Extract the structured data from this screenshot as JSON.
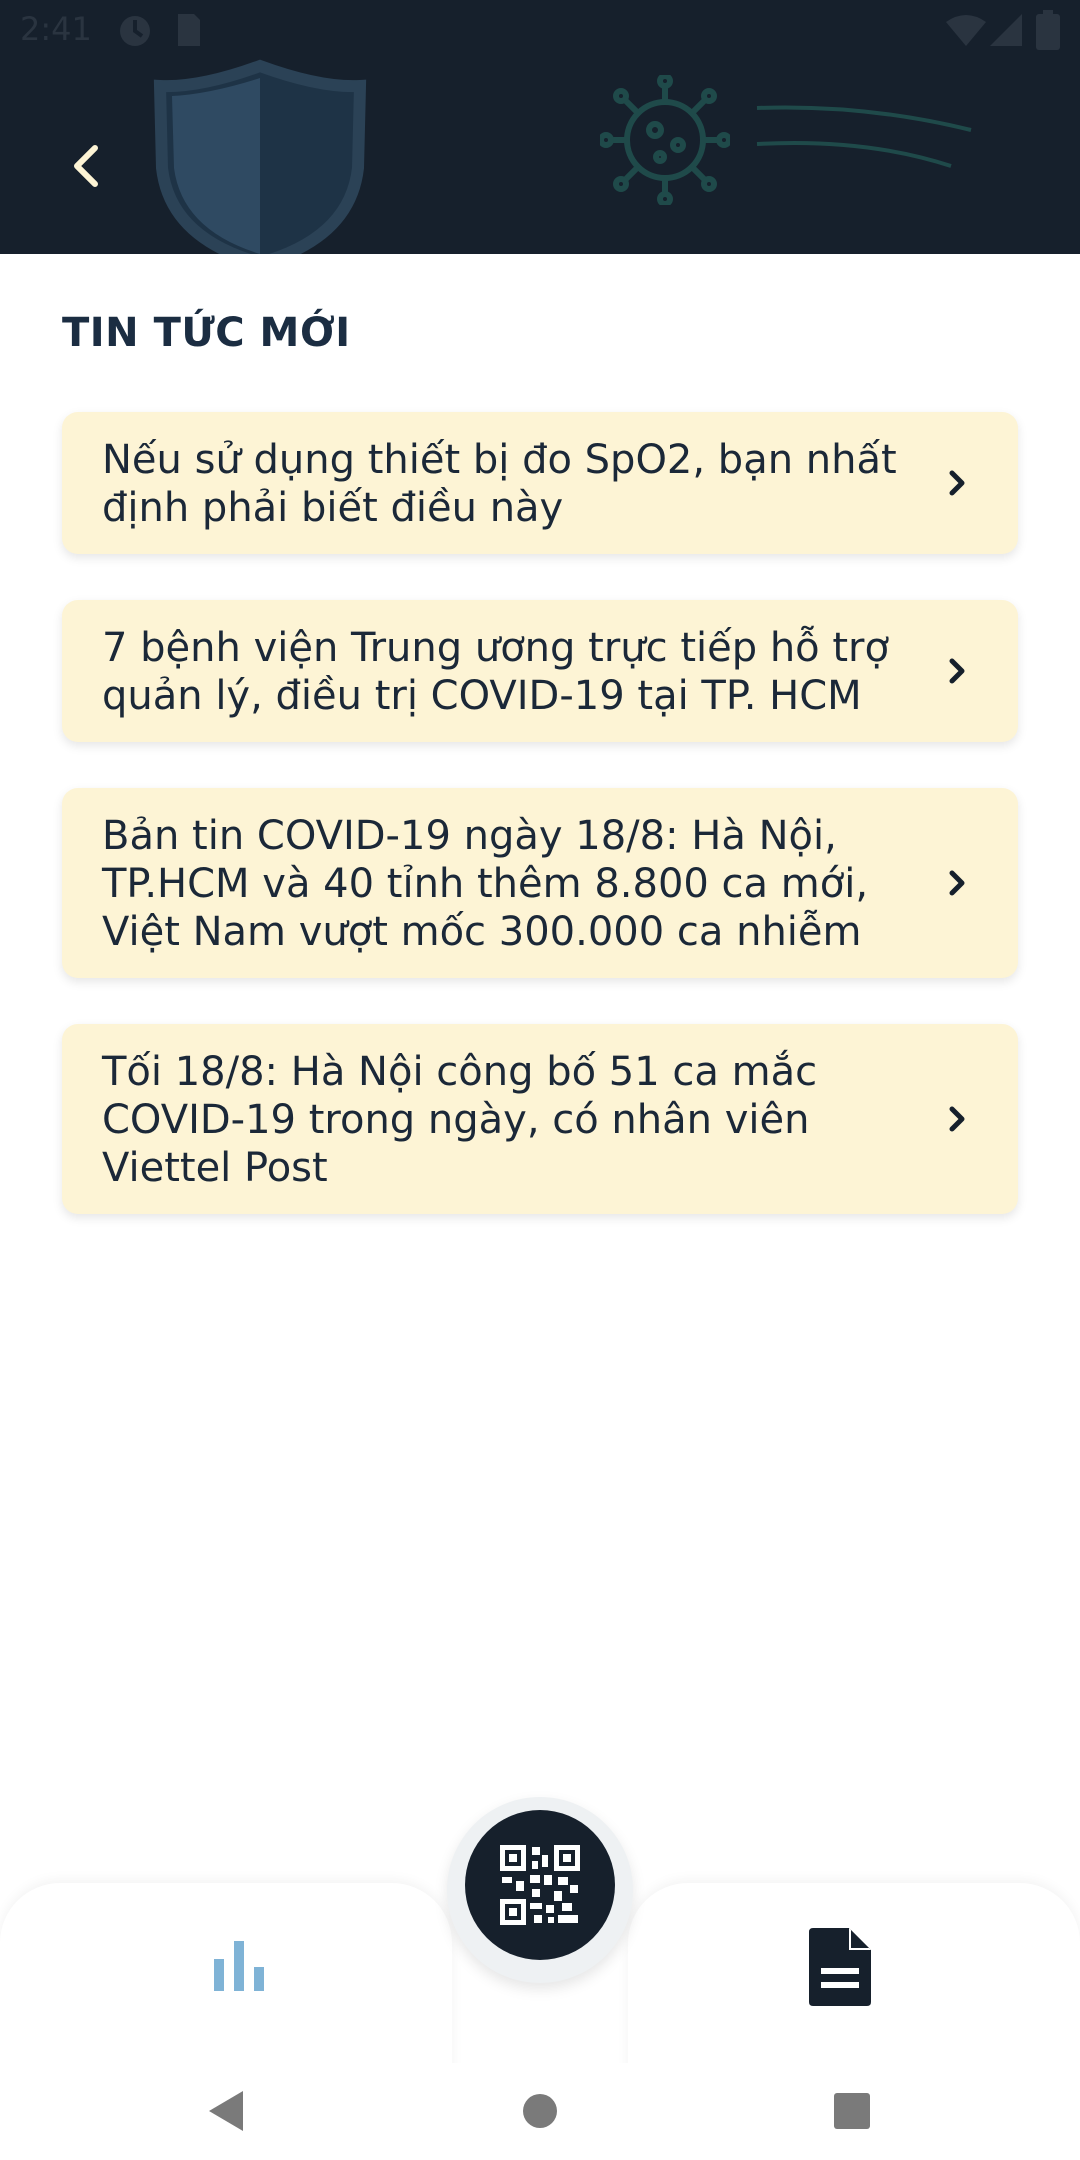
{
  "status_bar": {
    "time": "2:41"
  },
  "header": {
    "background_color": "#16202c",
    "back_icon": "chevron-left-icon",
    "decor_icons": [
      "shield-icon",
      "virus-icon"
    ]
  },
  "section": {
    "title": "TIN TỨC MỚI"
  },
  "news": {
    "card_color": "#fdf4d5",
    "items": [
      {
        "title": "Nếu sử dụng thiết bị đo SpO2, bạn nhất định phải biết điều này"
      },
      {
        "title": "7 bệnh viện Trung ương trực tiếp hỗ trợ quản lý, điều trị COVID-19 tại TP. HCM"
      },
      {
        "title": "Bản tin COVID-19 ngày 18/8: Hà Nội, TP.HCM và 40 tỉnh thêm 8.800 ca mới, Việt Nam vượt mốc 300.000 ca nhiễm"
      },
      {
        "title": "Tối 18/8: Hà Nội công bố 51 ca mắc COVID-19 trong ngày, có nhân viên Viettel Post"
      }
    ]
  },
  "bottom_nav": {
    "left_icon": "bar-chart-icon",
    "center_icon": "qr-code-icon",
    "right_icon": "document-icon",
    "active_color": "#16202c",
    "inactive_color": "#7fb3d6"
  },
  "system_nav": {
    "buttons": [
      "back-triangle-icon",
      "home-circle-icon",
      "recents-square-icon"
    ]
  }
}
